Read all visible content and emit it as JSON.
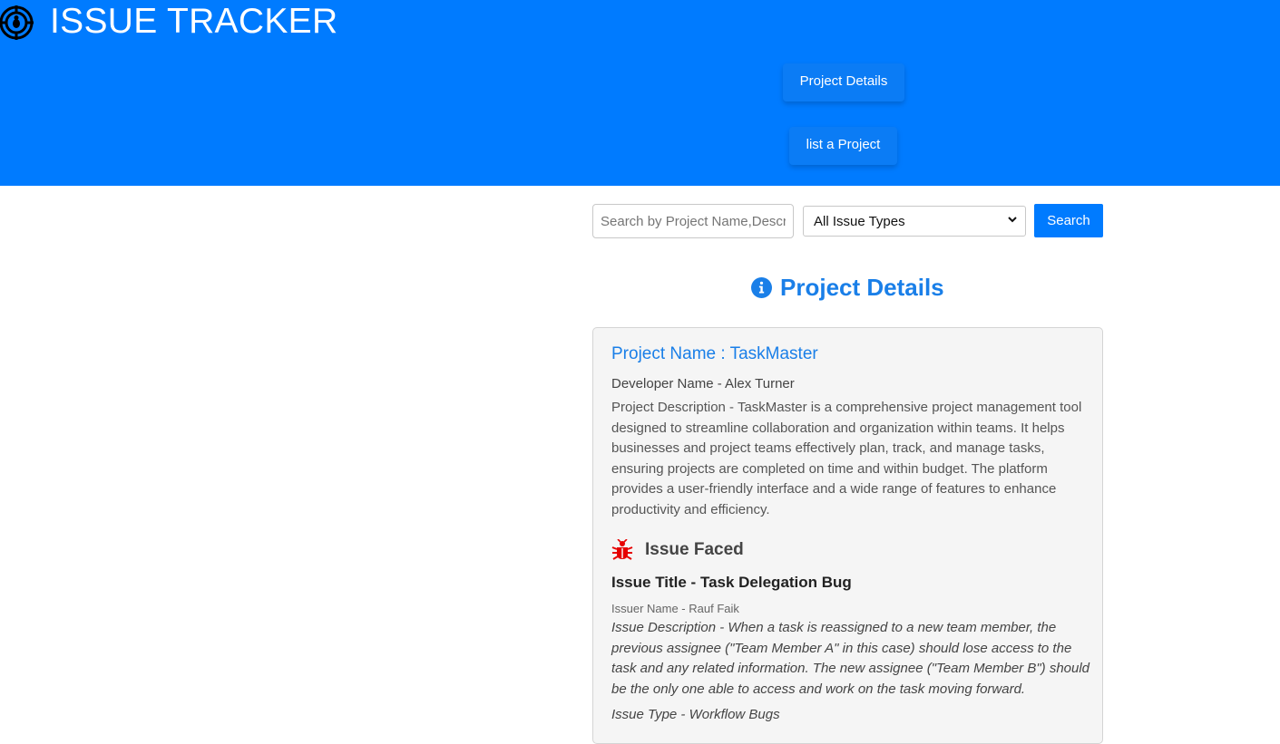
{
  "header": {
    "title": "ISSUE TRACKER",
    "logo_icon": "bug-target-icon",
    "nav": {
      "project_details": "Project Details",
      "list_project": "list a Project"
    }
  },
  "search": {
    "placeholder": "Search by Project Name,Description",
    "value": "",
    "issue_type_selected": "All Issue Types",
    "button_label": "Search"
  },
  "section": {
    "title": "Project Details",
    "icon": "info-circle-icon"
  },
  "project": {
    "name_line": "Project Name : TaskMaster",
    "developer_line": "Developer Name - Alex Turner",
    "description_line": "Project Description - TaskMaster is a comprehensive project management tool designed to streamline collaboration and organization within teams. It helps businesses and project teams effectively plan, track, and manage tasks, ensuring projects are completed on time and within budget. The platform provides a user-friendly interface and a wide range of features to enhance productivity and efficiency."
  },
  "issue": {
    "section_label": "Issue Faced",
    "icon": "bug-icon",
    "title_line": "Issue Title - Task Delegation Bug",
    "issuer_line": "Issuer Name - Rauf Faik",
    "description_line": "Issue Description - When a task is reassigned to a new team member, the previous assignee (\"Team Member A\" in this case) should lose access to the task and any related information. The new assignee (\"Team Member B\") should be the only one able to access and work on the task moving forward.",
    "type_line": "Issue Type - Workflow Bugs"
  },
  "colors": {
    "primary": "#007bff",
    "heading_blue": "#1a7fe8",
    "bug_red": "#e60000",
    "card_bg": "#f5f5f5"
  }
}
